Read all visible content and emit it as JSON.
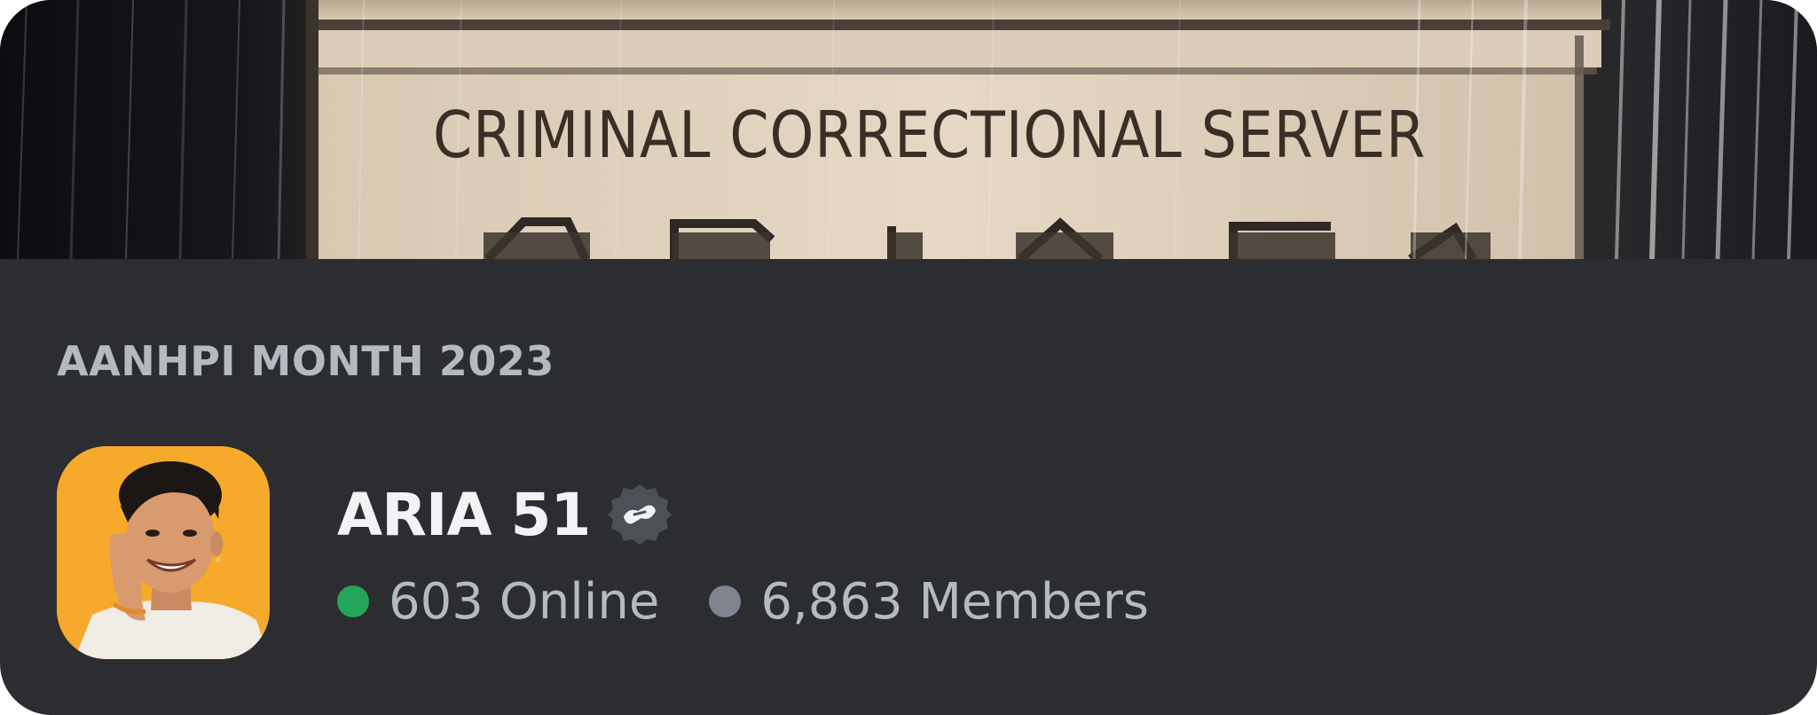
{
  "banner": {
    "image_text": "CRIMINAL CORRECTIONAL SERVER"
  },
  "event_label": "AANHPI MONTH 2023",
  "server": {
    "name": "ARIA 51",
    "badge_icon": "partner-badge-icon"
  },
  "stats": {
    "online_text": "603 Online",
    "members_text": "6,863 Members",
    "online_color": "#23a55a",
    "members_color": "#80848e"
  },
  "colors": {
    "card_background": "#2b2d31",
    "primary_text": "#f2f3f5",
    "secondary_text": "#b5bac1",
    "avatar_background": "#f7a92b"
  }
}
